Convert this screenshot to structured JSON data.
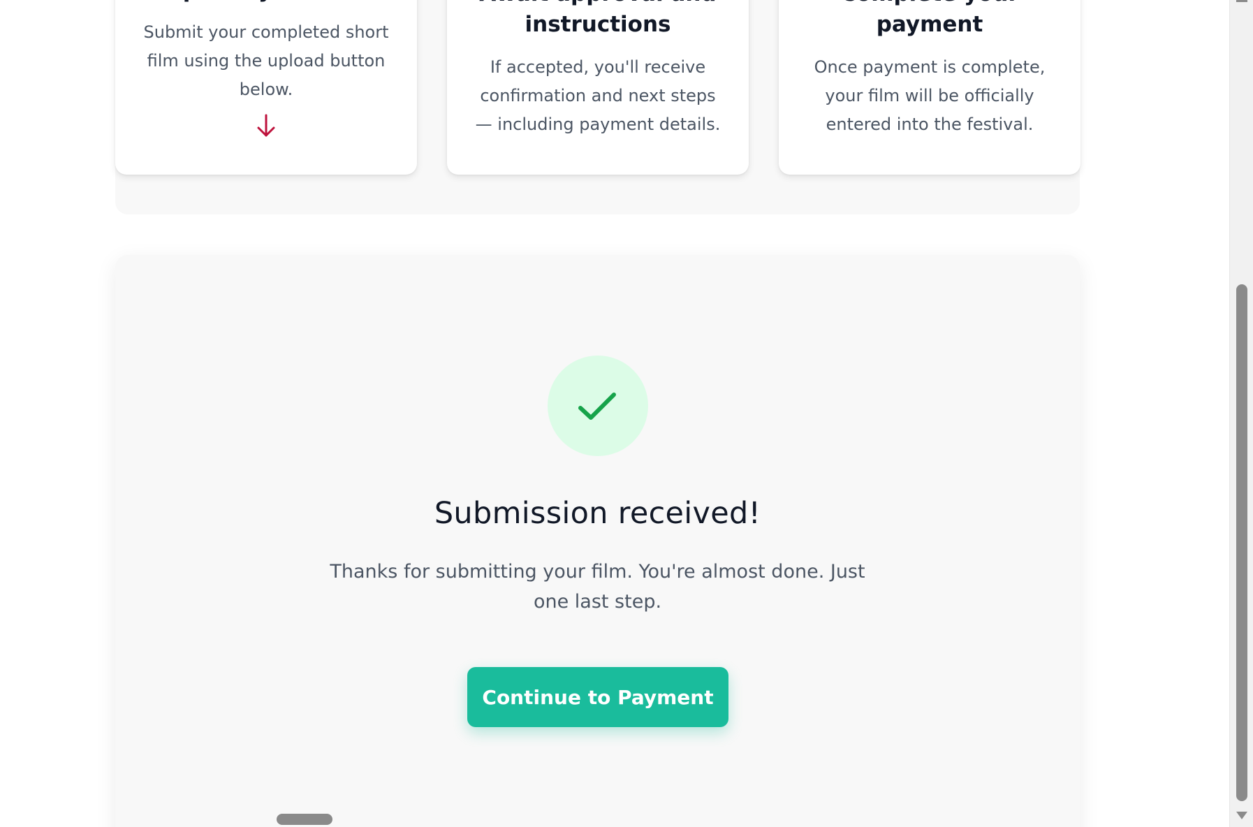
{
  "steps": [
    {
      "title": "Upload your film",
      "description": "Submit your completed short film using the upload button below.",
      "icon": "arrow-down-icon",
      "icon_color": "#be123c"
    },
    {
      "title": "Await approval and instructions",
      "description": "If accepted, you'll receive confirmation and next steps — including payment details."
    },
    {
      "title": "Complete your payment",
      "description": "Once payment is complete, your film will be officially entered into the festival."
    }
  ],
  "success": {
    "icon": "checkmark-icon",
    "icon_color": "#16a34a",
    "icon_bg": "#dcfce7",
    "title": "Submission received!",
    "message": "Thanks for submitting your film. You're almost done. Just one last step.",
    "button_label": "Continue to Payment",
    "button_color": "#1abc9c"
  }
}
